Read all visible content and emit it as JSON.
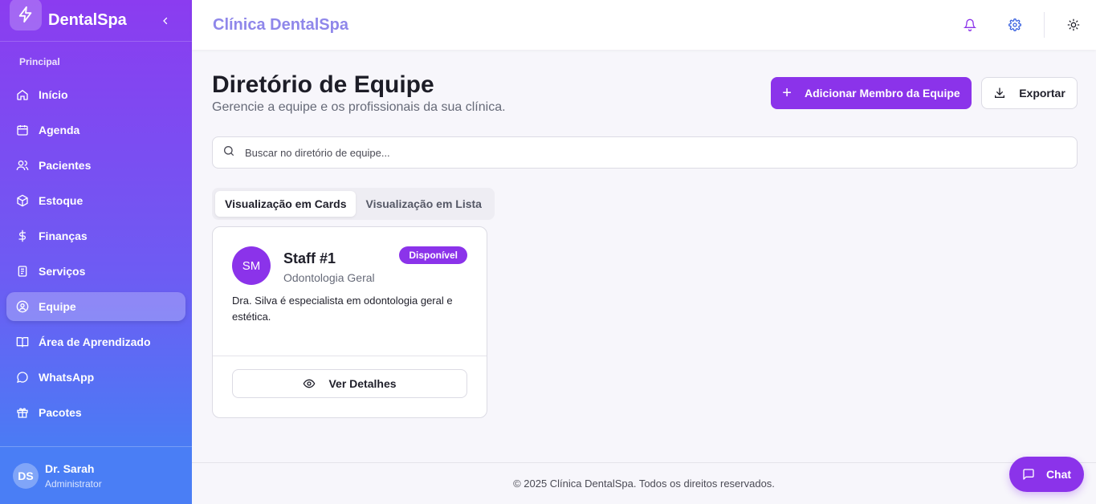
{
  "sidebar": {
    "brand": "DentalSpa",
    "section_label": "Principal",
    "items": [
      {
        "label": "Início",
        "icon": "home-icon"
      },
      {
        "label": "Agenda",
        "icon": "calendar-icon"
      },
      {
        "label": "Pacientes",
        "icon": "users-icon"
      },
      {
        "label": "Estoque",
        "icon": "package-icon"
      },
      {
        "label": "Finanças",
        "icon": "dollar-icon"
      },
      {
        "label": "Serviços",
        "icon": "clipboard-icon"
      },
      {
        "label": "Equipe",
        "icon": "user-circle-icon",
        "active": true
      },
      {
        "label": "Área de Aprendizado",
        "icon": "book-icon"
      },
      {
        "label": "WhatsApp",
        "icon": "message-icon"
      },
      {
        "label": "Pacotes",
        "icon": "gift-icon"
      }
    ],
    "user": {
      "initials": "DS",
      "name": "Dr. Sarah",
      "role": "Administrator"
    }
  },
  "topbar": {
    "title": "Clínica DentalSpa",
    "icons": [
      "bell-icon",
      "gear-icon",
      "sun-icon"
    ]
  },
  "main": {
    "title": "Diretório de Equipe",
    "subtitle": "Gerencie a equipe e os profissionais da sua clínica.",
    "add_button": "Adicionar Membro da Equipe",
    "export_button": "Exportar",
    "search_placeholder": "Buscar no diretório de equipe...",
    "tabs": [
      {
        "label": "Visualização em Cards",
        "active": true
      },
      {
        "label": "Visualização em Lista",
        "active": false
      }
    ],
    "card": {
      "initials": "SM",
      "name": "Staff #1",
      "specialty": "Odontologia Geral",
      "status": "Disponível",
      "description": "Dra. Silva é especialista em odontologia geral e estética.",
      "details_button": "Ver Detalhes"
    }
  },
  "footer": {
    "text": "© 2025 Clínica DentalSpa. Todos os direitos reservados."
  },
  "chat": {
    "label": "Chat"
  },
  "colors": {
    "accent": "#8b33ea",
    "title_color": "#8f87ea",
    "sidebar_top": "#8b3cf0",
    "sidebar_bottom": "#3f86f5"
  }
}
